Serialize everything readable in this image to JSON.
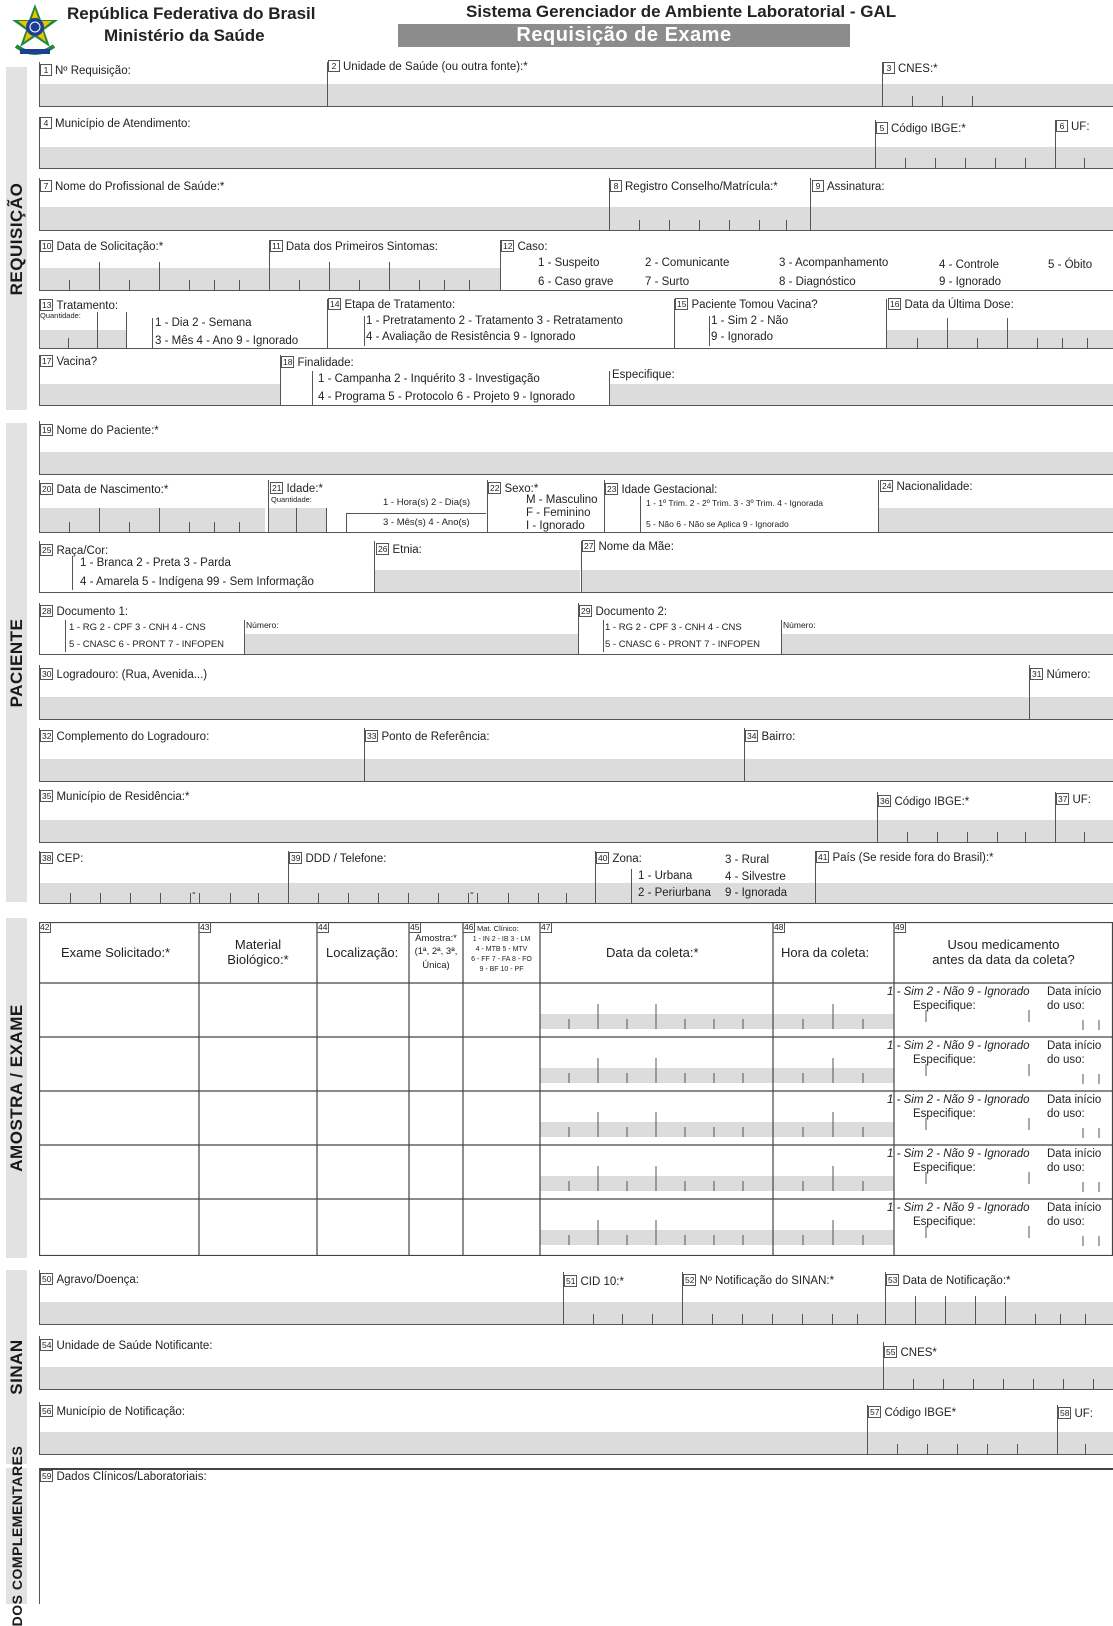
{
  "header": {
    "org_line1": "República Federativa do Brasil",
    "org_line2": "Ministério da Saúde",
    "system": "Sistema Gerenciador de Ambiente Laboratorial - GAL",
    "form_title": "Requisição de Exame"
  },
  "sections": {
    "requisicao": "REQUISIÇÃO",
    "paciente": "PACIENTE",
    "amostra": "AMOSTRA / EXAME",
    "sinan": "SINAN",
    "complementares": "DOS COMPLEMENTARES"
  },
  "fields": {
    "f1": "1",
    "f1_label": "Nº Requisição:",
    "f2": "2",
    "f2_label": "Unidade de Saúde (ou outra fonte):*",
    "f3": "3",
    "f3_label": "CNES:*",
    "f4": "4",
    "f4_label": "Município de Atendimento:",
    "f5": "5",
    "f5_label": "Código IBGE:*",
    "f6": "6",
    "f6_label": "UF:",
    "f7": "7",
    "f7_label": "Nome do Profissional de Saúde:*",
    "f8": "8",
    "f8_label": "Registro Conselho/Matrícula:*",
    "f9": "9",
    "f9_label": "Assinatura:",
    "f10": "10",
    "f10_label": "Data de Solicitação:*",
    "f11": "11",
    "f11_label": "Data dos Primeiros Sintomas:",
    "f12": "12",
    "f12_label": "Caso:",
    "f12_o1": "1 - Suspeito",
    "f12_o2": "2 - Comunicante",
    "f12_o3": "3 - Acompanhamento",
    "f12_o4": "4 - Controle",
    "f12_o5": "5 - Óbito",
    "f12_o6": "6 - Caso grave",
    "f12_o7": "7 - Surto",
    "f12_o8": "8 - Diagnóstico",
    "f12_o9": "9 - Ignorado",
    "f13": "13",
    "f13_label": "Tratamento:",
    "f13_qty": "Quantidade:",
    "f13_o1": "1 - Dia   2 - Semana",
    "f13_o2": "3 - Mês   4 - Ano  9 - Ignorado",
    "f14": "14",
    "f14_label": "Etapa de Tratamento:",
    "f14_o1": "1 - Pretratamento   2 - Tratamento  3 - Retratamento",
    "f14_o2": "4 - Avaliação de Resistência         9 - Ignorado",
    "f15": "15",
    "f15_label": "Paciente Tomou Vacina?",
    "f15_o1": "1 - Sim        2 - Não",
    "f15_o2": "9 - Ignorado",
    "f16": "16",
    "f16_label": "Data da Última Dose:",
    "f17": "17",
    "f17_label": "Vacina?",
    "f18": "18",
    "f18_label": "Finalidade:",
    "f18_o1": "1 - Campanha      2 - Inquérito     3 - Investigação",
    "f18_o2": "4 - Programa  5 - Protocolo  6 - Projeto  9 - Ignorado",
    "f18_spec": "Especifique:",
    "f19": "19",
    "f19_label": "Nome do Paciente:*",
    "f20": "20",
    "f20_label": "Data de Nascimento:*",
    "f21": "21",
    "f21_label": "Idade:*",
    "f21_qty": "Quantidade:",
    "f21_o1": "1 - Hora(s)  2 - Dia(s)",
    "f21_o2": "3 - Mês(s)   4 - Ano(s)",
    "f22": "22",
    "f22_label": "Sexo:*",
    "f22_o1": "M - Masculino",
    "f22_o2": "F  - Feminino",
    "f22_o3": "I   - Ignorado",
    "f23": "23",
    "f23_label": "Idade Gestacional:",
    "f23_o1": "1 - 1º Trim.    2 - 2º Trim.    3 - 3º Trim.   4 - Ignorada",
    "f23_o2": "5 - Não    6 - Não se Aplica    9 - Ignorado",
    "f24": "24",
    "f24_label": "Nacionalidade:",
    "f25": "25",
    "f25_label": "Raça/Cor:",
    "f25_o1": "1 - Branca       2 - Preta        3 - Parda",
    "f25_o2": "4 - Amarela      5 - Indígena   99 - Sem Informação",
    "f26": "26",
    "f26_label": "Etnia:",
    "f27": "27",
    "f27_label": "Nome da Mãe:",
    "f28": "28",
    "f28_label": "Documento 1:",
    "f28_o1": "1 - RG    2 - CPF    3 - CNH    4 - CNS",
    "f28_o2": "5 - CNASC   6 - PRONT   7 - INFOPEN",
    "f28_num": "Número:",
    "f29": "29",
    "f29_label": "Documento 2:",
    "f29_o1": "1 - RG    2 - CPF    3 - CNH    4 - CNS",
    "f29_o2": "5 - CNASC   6 - PRONT   7 - INFOPEN",
    "f29_num": "Número:",
    "f30": "30",
    "f30_label": "Logradouro: (Rua, Avenida...)",
    "f31": "31",
    "f31_label": "Número:",
    "f32": "32",
    "f32_label": "Complemento do Logradouro:",
    "f33": "33",
    "f33_label": "Ponto de Referência:",
    "f34": "34",
    "f34_label": "Bairro:",
    "f35": "35",
    "f35_label": "Município de Residência:*",
    "f36": "36",
    "f36_label": "Código IBGE:*",
    "f37": "37",
    "f37_label": "UF:",
    "f38": "38",
    "f38_label": "CEP:",
    "f38_dash": "-",
    "f39": "39",
    "f39_label": "DDD / Telefone:",
    "f39_dash": "-",
    "f40": "40",
    "f40_label": "Zona:",
    "f40_o1": "1 - Urbana",
    "f40_o2": "2 - Periurbana",
    "f40_o3": "3 - Rural",
    "f40_o4": "4 - Silvestre",
    "f40_o5": "9 - Ignorada",
    "f41": "41",
    "f41_label": "País (Se reside fora do Brasil):*"
  },
  "exam_table": {
    "h42": "42",
    "h42_label": "Exame Solicitado:*",
    "h43": "43",
    "h43_label1": "Material",
    "h43_label2": "Biológico:*",
    "h44": "44",
    "h44_label": "Localização:",
    "h45": "45",
    "h45_l1": "Amostra:*",
    "h45_l2": "(1ª, 2ª, 3ª,",
    "h45_l3": "Única)",
    "h46": "46",
    "h46_l1": "Mat. Clínico:",
    "h46_l2": "1 - IN  2 - IB  3 - LM",
    "h46_l3": "4 - MTB   5 - MTV",
    "h46_l4": "6 - FF  7 - FA  8 - FO",
    "h46_l5": "9 - BF  10 - PF",
    "h47": "47",
    "h47_label": "Data da coleta:*",
    "h48": "48",
    "h48_label": "Hora da coleta:",
    "h49": "49",
    "h49_l1": "Usou medicamento",
    "h49_l2": "antes da data da coleta?",
    "row_opts": "1 - Sim  2 - Não  9 - Ignorado",
    "row_start": "Data início",
    "row_spec": "Especifique:",
    "row_use": "do uso:"
  },
  "sinan": {
    "f50": "50",
    "f50_label": "Agravo/Doença:",
    "f51": "51",
    "f51_label": "CID 10:*",
    "f52": "52",
    "f52_label": "Nº Notificação do SINAN:*",
    "f53": "53",
    "f53_label": "Data de Notificação:*",
    "f54": "54",
    "f54_label": "Unidade de Saúde Notificante:",
    "f55": "55",
    "f55_label": "CNES*",
    "f56": "56",
    "f56_label": "Município de Notificação:",
    "f57": "57",
    "f57_label": "Código IBGE*",
    "f58": "58",
    "f58_label": "UF:"
  },
  "complementares": {
    "f59": "59",
    "f59_label": "Dados Clínicos/Laboratoriais:"
  }
}
